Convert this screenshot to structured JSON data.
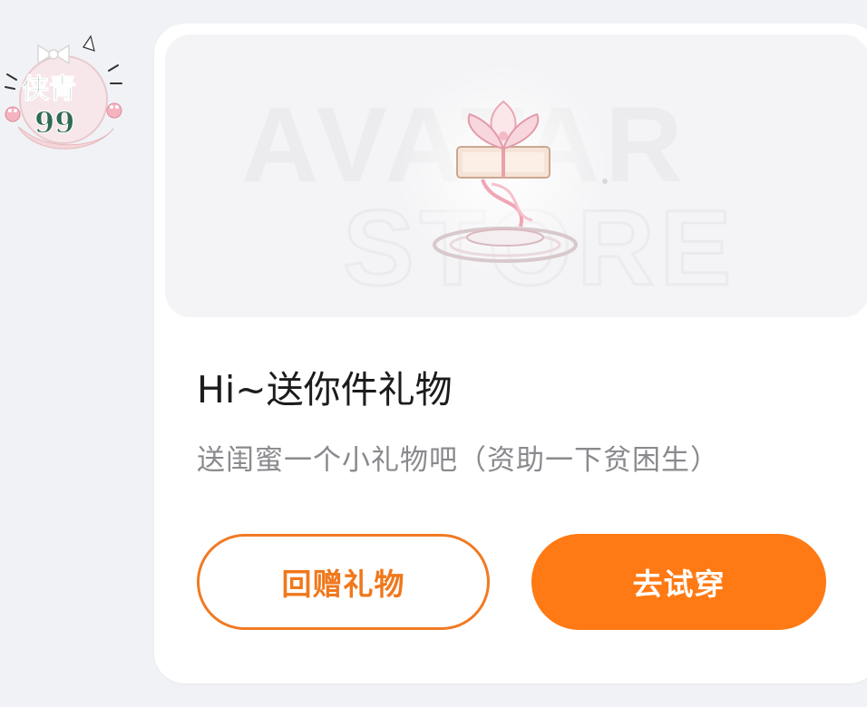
{
  "avatar": {
    "text_line1": "侠青",
    "text_line2": "99"
  },
  "banner": {
    "watermark_line1": "AVATAR",
    "watermark_line2": "STORE",
    "gift_icon": "lotus-gift-icon"
  },
  "card": {
    "title": "Hi~送你件礼物",
    "subtitle": "送闺蜜一个小礼物吧（资助一下贫困生）"
  },
  "buttons": {
    "return_gift": "回赠礼物",
    "try_on": "去试穿"
  },
  "colors": {
    "accent": "#ff7a14",
    "outline": "#f07a24",
    "background": "#f1f2f5",
    "card": "#ffffff"
  }
}
